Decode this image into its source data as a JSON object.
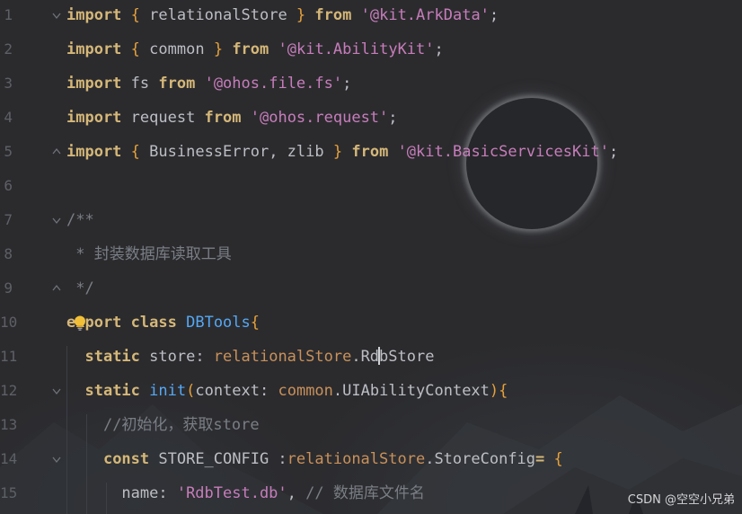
{
  "editor": {
    "line_numbers": [
      "1",
      "2",
      "3",
      "4",
      "5",
      "6",
      "7",
      "8",
      "9",
      "10",
      "11",
      "12",
      "13",
      "14",
      "15"
    ],
    "lines": [
      [
        {
          "t": "import",
          "c": "kw"
        },
        {
          "t": " ",
          "c": "punc"
        },
        {
          "t": "{",
          "c": "punc-brace"
        },
        {
          "t": " relationalStore ",
          "c": "ident"
        },
        {
          "t": "}",
          "c": "punc-brace"
        },
        {
          "t": " ",
          "c": "punc"
        },
        {
          "t": "from",
          "c": "kw"
        },
        {
          "t": " ",
          "c": "punc"
        },
        {
          "t": "'@kit.ArkData'",
          "c": "str"
        },
        {
          "t": ";",
          "c": "punc"
        }
      ],
      [
        {
          "t": "import",
          "c": "kw"
        },
        {
          "t": " ",
          "c": "punc"
        },
        {
          "t": "{",
          "c": "punc-brace"
        },
        {
          "t": " common ",
          "c": "ident"
        },
        {
          "t": "}",
          "c": "punc-brace"
        },
        {
          "t": " ",
          "c": "punc"
        },
        {
          "t": "from",
          "c": "kw"
        },
        {
          "t": " ",
          "c": "punc"
        },
        {
          "t": "'@kit.AbilityKit'",
          "c": "str"
        },
        {
          "t": ";",
          "c": "punc"
        }
      ],
      [
        {
          "t": "import",
          "c": "kw"
        },
        {
          "t": " fs ",
          "c": "ident"
        },
        {
          "t": "from",
          "c": "kw"
        },
        {
          "t": " ",
          "c": "punc"
        },
        {
          "t": "'@ohos.file.fs'",
          "c": "str"
        },
        {
          "t": ";",
          "c": "punc"
        }
      ],
      [
        {
          "t": "import",
          "c": "kw"
        },
        {
          "t": " request ",
          "c": "ident"
        },
        {
          "t": "from",
          "c": "kw"
        },
        {
          "t": " ",
          "c": "punc"
        },
        {
          "t": "'@ohos.request'",
          "c": "str"
        },
        {
          "t": ";",
          "c": "punc"
        }
      ],
      [
        {
          "t": "import",
          "c": "kw"
        },
        {
          "t": " ",
          "c": "punc"
        },
        {
          "t": "{",
          "c": "punc-brace"
        },
        {
          "t": " BusinessError, zlib ",
          "c": "ident"
        },
        {
          "t": "}",
          "c": "punc-brace"
        },
        {
          "t": " ",
          "c": "punc"
        },
        {
          "t": "from",
          "c": "kw"
        },
        {
          "t": " ",
          "c": "punc"
        },
        {
          "t": "'@kit.BasicServicesKit'",
          "c": "str"
        },
        {
          "t": ";",
          "c": "punc"
        }
      ],
      [],
      [
        {
          "t": "/**",
          "c": "comment"
        }
      ],
      [
        {
          "t": " * 封装数据库读取工具",
          "c": "comment"
        }
      ],
      [
        {
          "t": " */",
          "c": "comment"
        }
      ],
      [
        {
          "t": "export",
          "c": "kw"
        },
        {
          "t": " ",
          "c": "punc"
        },
        {
          "t": "class",
          "c": "kw"
        },
        {
          "t": " ",
          "c": "punc"
        },
        {
          "t": "DBTools",
          "c": "cls"
        },
        {
          "t": "{",
          "c": "punc-brace"
        }
      ],
      [
        {
          "t": "  ",
          "c": "punc"
        },
        {
          "t": "static",
          "c": "kw"
        },
        {
          "t": " store: ",
          "c": "ident"
        },
        {
          "t": "relationalStore",
          "c": "type"
        },
        {
          "t": ".Rd",
          "c": "ident"
        },
        {
          "t": "",
          "c": "caret"
        },
        {
          "t": "bStore",
          "c": "ident"
        }
      ],
      [
        {
          "t": "  ",
          "c": "punc"
        },
        {
          "t": "static",
          "c": "kw"
        },
        {
          "t": " ",
          "c": "punc"
        },
        {
          "t": "init",
          "c": "method"
        },
        {
          "t": "(",
          "c": "punc-brace"
        },
        {
          "t": "context: ",
          "c": "ident"
        },
        {
          "t": "common",
          "c": "type"
        },
        {
          "t": ".UIAbilityContext",
          "c": "ident"
        },
        {
          "t": ")",
          "c": "punc-brace"
        },
        {
          "t": "{",
          "c": "punc-brace"
        }
      ],
      [
        {
          "t": "    ",
          "c": "punc"
        },
        {
          "t": "//初始化，获取store",
          "c": "comment"
        }
      ],
      [
        {
          "t": "    ",
          "c": "punc"
        },
        {
          "t": "const",
          "c": "kw"
        },
        {
          "t": " STORE_CONFIG :",
          "c": "ident"
        },
        {
          "t": "relationalStore",
          "c": "type"
        },
        {
          "t": ".StoreConfig",
          "c": "ident"
        },
        {
          "t": "=",
          "c": "kw"
        },
        {
          "t": " ",
          "c": "punc"
        },
        {
          "t": "{",
          "c": "punc-brace"
        }
      ],
      [
        {
          "t": "      name: ",
          "c": "ident"
        },
        {
          "t": "'RdbTest.db'",
          "c": "str"
        },
        {
          "t": ", ",
          "c": "punc"
        },
        {
          "t": "// 数据库文件名",
          "c": "comment"
        }
      ]
    ]
  },
  "watermark": "CSDN @空空小兄弟",
  "icons": {
    "bulb": "lightbulb-icon",
    "fold": "fold-icon"
  },
  "colors": {
    "background": "#2b2b2e",
    "keyword": "#d5b778",
    "string": "#c77dbb",
    "comment": "#7a7e85",
    "class_name": "#56a8f5",
    "type_ref": "#c9915a",
    "brace": "#e6a13a",
    "text": "#bcbec4"
  }
}
